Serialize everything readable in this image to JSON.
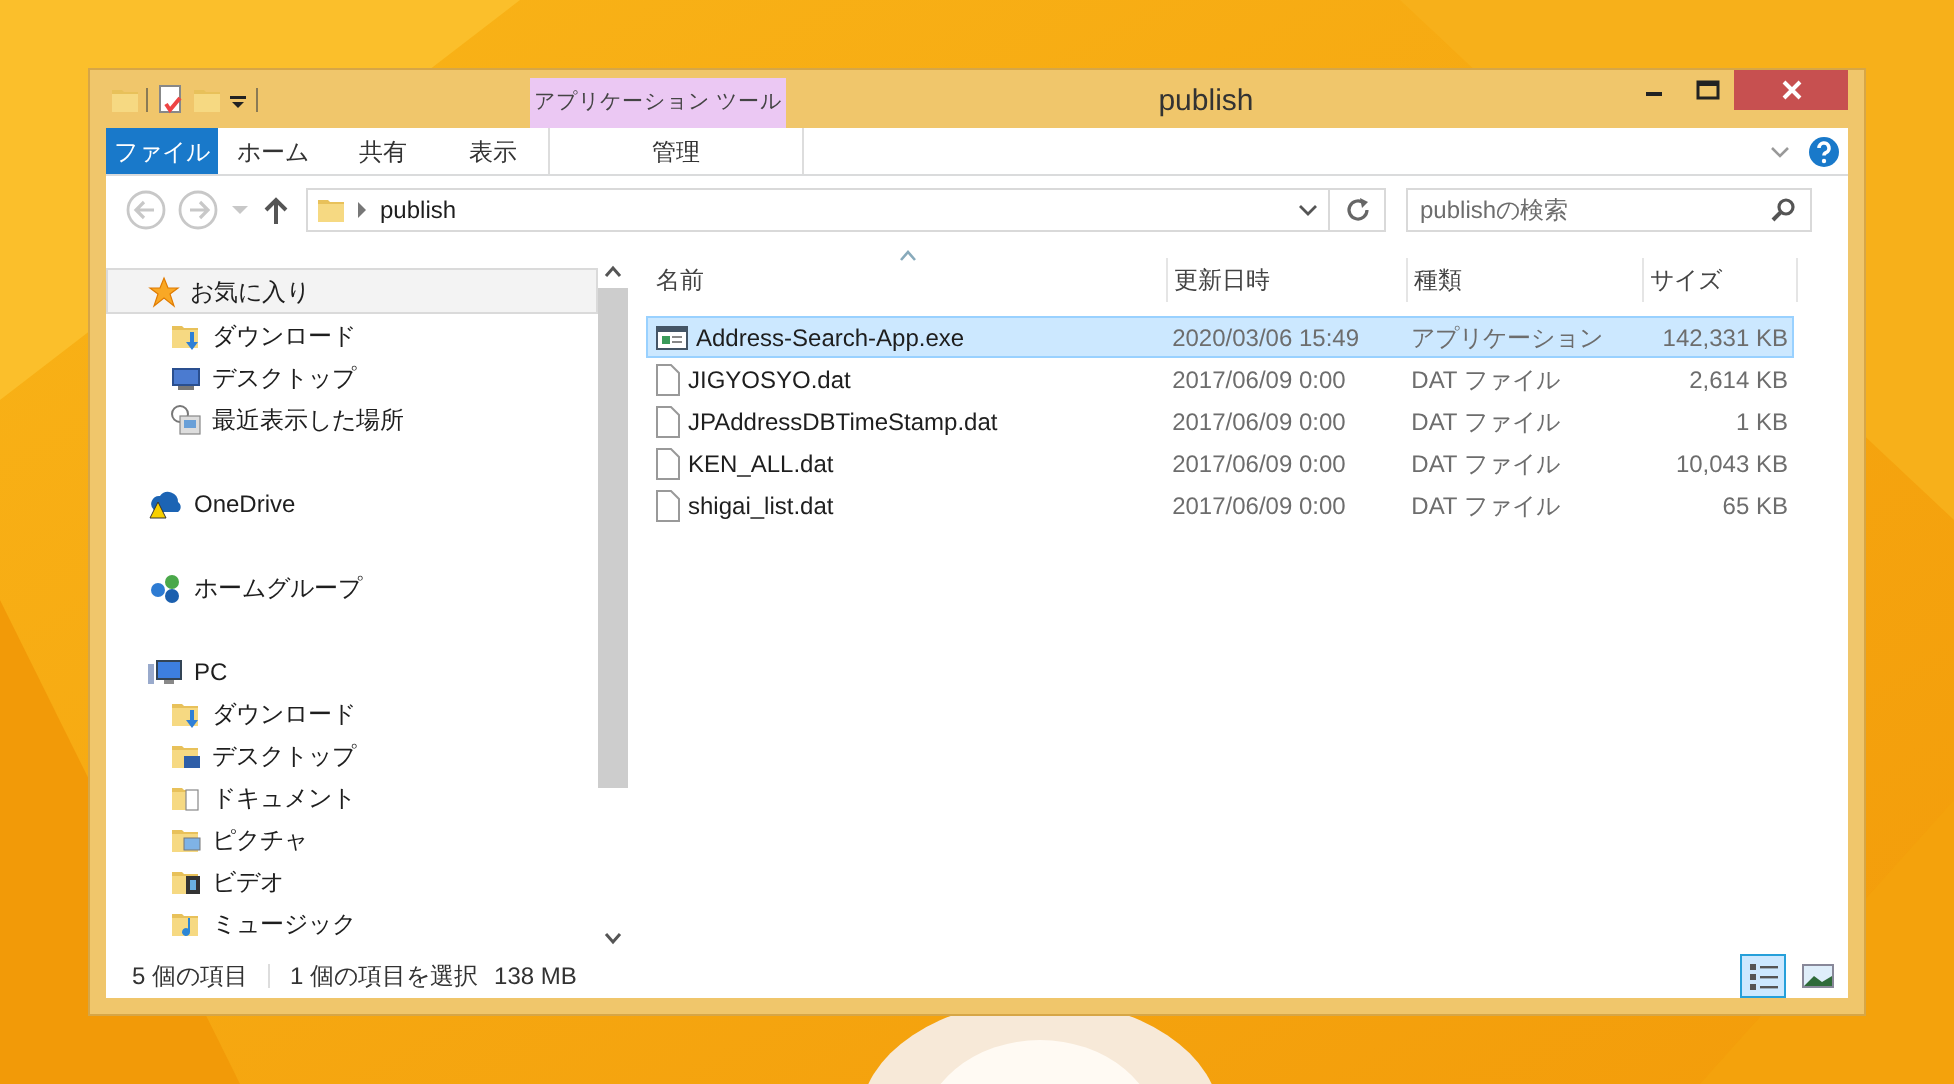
{
  "window": {
    "title": "publish"
  },
  "context_tab_group": "アプリケーション ツール",
  "ribbon_tabs": [
    {
      "label": "ファイル",
      "kind": "file",
      "selected": false
    },
    {
      "label": "ホーム",
      "kind": "tab",
      "selected": false
    },
    {
      "label": "共有",
      "kind": "tab",
      "selected": false
    },
    {
      "label": "表示",
      "kind": "tab",
      "selected": false
    },
    {
      "label": "管理",
      "kind": "context",
      "selected": false
    }
  ],
  "address": {
    "path": [
      "publish"
    ]
  },
  "search": {
    "placeholder": "publishの検索"
  },
  "navigation": [
    {
      "label": "お気に入り",
      "kind": "favorites",
      "selected": true,
      "children": [
        {
          "label": "ダウンロード",
          "kind": "downloads",
          "selected": false
        },
        {
          "label": "デスクトップ",
          "kind": "desktop",
          "selected": false
        },
        {
          "label": "最近表示した場所",
          "kind": "recent",
          "selected": false
        }
      ]
    },
    {
      "label": "OneDrive",
      "kind": "onedrive",
      "selected": false
    },
    {
      "label": "ホームグループ",
      "kind": "homegroup",
      "selected": false
    },
    {
      "label": "PC",
      "kind": "pc",
      "selected": false,
      "children": [
        {
          "label": "ダウンロード",
          "kind": "downloads",
          "selected": false
        },
        {
          "label": "デスクトップ",
          "kind": "desktop-folder",
          "selected": false
        },
        {
          "label": "ドキュメント",
          "kind": "documents",
          "selected": false
        },
        {
          "label": "ピクチャ",
          "kind": "pictures",
          "selected": false
        },
        {
          "label": "ビデオ",
          "kind": "videos",
          "selected": false
        },
        {
          "label": "ミュージック",
          "kind": "music",
          "selected": false
        }
      ]
    }
  ],
  "columns": [
    {
      "label": "名前",
      "sorted": true
    },
    {
      "label": "更新日時",
      "sorted": false
    },
    {
      "label": "種類",
      "sorted": false
    },
    {
      "label": "サイズ",
      "sorted": false
    }
  ],
  "files": [
    {
      "name": "Address-Search-App.exe",
      "modified": "2020/03/06 15:49",
      "type": "アプリケーション",
      "size": "142,331 KB",
      "kind": "exe",
      "selected": true
    },
    {
      "name": "JIGYOSYO.dat",
      "modified": "2017/06/09 0:00",
      "type": "DAT ファイル",
      "size": "2,614 KB",
      "kind": "file",
      "selected": false
    },
    {
      "name": "JPAddressDBTimeStamp.dat",
      "modified": "2017/06/09 0:00",
      "type": "DAT ファイル",
      "size": "1 KB",
      "kind": "file",
      "selected": false
    },
    {
      "name": "KEN_ALL.dat",
      "modified": "2017/06/09 0:00",
      "type": "DAT ファイル",
      "size": "10,043 KB",
      "kind": "file",
      "selected": false
    },
    {
      "name": "shigai_list.dat",
      "modified": "2017/06/09 0:00",
      "type": "DAT ファイル",
      "size": "65 KB",
      "kind": "file",
      "selected": false
    }
  ],
  "status_bar": {
    "item_count": "5 個の項目",
    "selection": "1 個の項目を選択",
    "selection_size": "138 MB"
  },
  "views": [
    {
      "kind": "details",
      "selected": true
    },
    {
      "kind": "large-icons",
      "selected": false
    }
  ]
}
